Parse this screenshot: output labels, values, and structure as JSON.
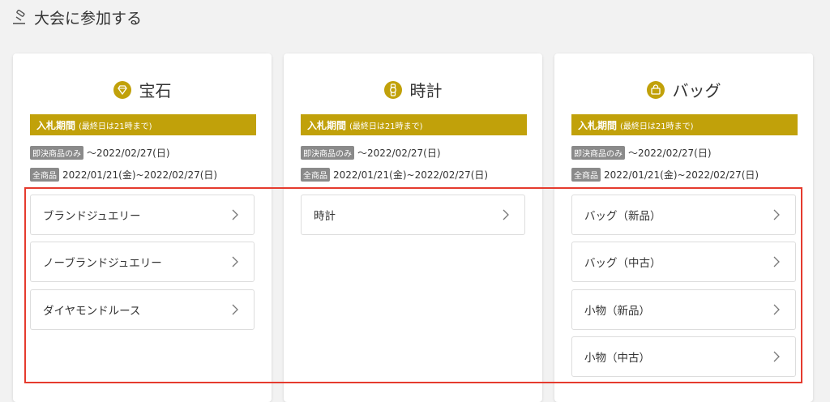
{
  "header": {
    "title": "大会に参加する",
    "icon": "gavel-icon"
  },
  "cards": [
    {
      "icon": "gem-icon",
      "name": "宝石",
      "bid_label": "入札期間",
      "bid_note": "(最終日は21時まで)",
      "instant_tag": "即決商品のみ",
      "instant_period": "～2022/02/27(日)",
      "all_tag": "全商品",
      "all_period": "2022/01/21(金)~2022/02/27(日)",
      "items": [
        "ブランドジュエリー",
        "ノーブランドジュエリー",
        "ダイヤモンドルース"
      ]
    },
    {
      "icon": "watch-icon",
      "name": "時計",
      "bid_label": "入札期間",
      "bid_note": "(最終日は21時まで)",
      "instant_tag": "即決商品のみ",
      "instant_period": "～2022/02/27(日)",
      "all_tag": "全商品",
      "all_period": "2022/01/21(金)~2022/02/27(日)",
      "items": [
        "時計"
      ]
    },
    {
      "icon": "bag-icon",
      "name": "バッグ",
      "bid_label": "入札期間",
      "bid_note": "(最終日は21時まで)",
      "instant_tag": "即決商品のみ",
      "instant_period": "～2022/02/27(日)",
      "all_tag": "全商品",
      "all_period": "2022/01/21(金)~2022/02/27(日)",
      "items": [
        "バッグ（新品）",
        "バッグ（中古）",
        "小物（新品）",
        "小物（中古）"
      ]
    }
  ],
  "colors": {
    "accent": "#c1a10a",
    "highlight": "#e53b2e",
    "tag": "#8a8a8a"
  }
}
